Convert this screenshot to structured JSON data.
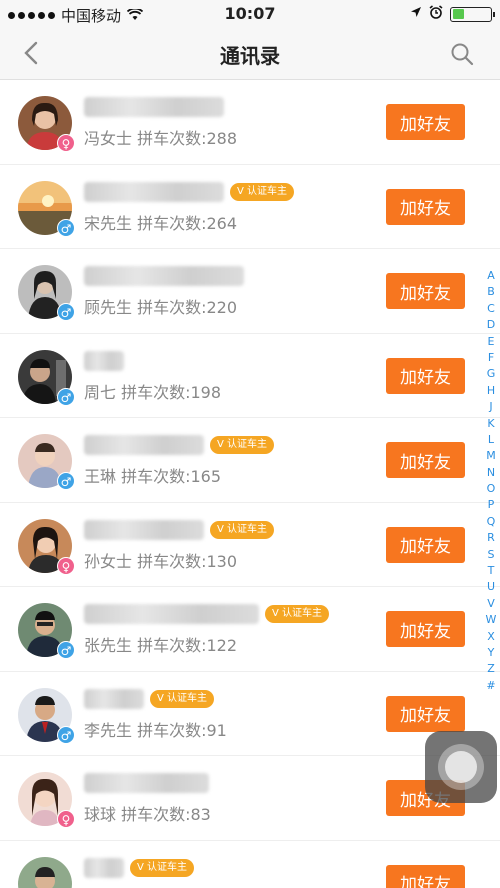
{
  "statusbar": {
    "carrier": "中国移动",
    "time": "10:07"
  },
  "navbar": {
    "title": "通讯录"
  },
  "add_label": "加好友",
  "verified_label": "V 认证车主",
  "contacts": [
    {
      "subtitle": "冯女士 拼车次数:288",
      "gender": "female",
      "symbol": "♀",
      "verified": false
    },
    {
      "subtitle": "宋先生 拼车次数:264",
      "gender": "male",
      "symbol": "♂",
      "verified": true
    },
    {
      "subtitle": "顾先生 拼车次数:220",
      "gender": "male",
      "symbol": "♂",
      "verified": false
    },
    {
      "subtitle": "周七 拼车次数:198",
      "gender": "male",
      "symbol": "♂",
      "verified": false
    },
    {
      "subtitle": "王琳 拼车次数:165",
      "gender": "male",
      "symbol": "♂",
      "verified": true
    },
    {
      "subtitle": "孙女士 拼车次数:130",
      "gender": "female",
      "symbol": "♀",
      "verified": true
    },
    {
      "subtitle": "张先生 拼车次数:122",
      "gender": "male",
      "symbol": "♂",
      "verified": true
    },
    {
      "subtitle": "李先生 拼车次数:91",
      "gender": "male",
      "symbol": "♂",
      "verified": true
    },
    {
      "subtitle": "球球 拼车次数:83",
      "gender": "female",
      "symbol": "♀",
      "verified": false
    },
    {
      "subtitle": "",
      "gender": "male",
      "symbol": "♂",
      "verified": true
    }
  ],
  "index_letters": [
    "A",
    "B",
    "C",
    "D",
    "E",
    "F",
    "G",
    "H",
    "J",
    "K",
    "L",
    "M",
    "N",
    "O",
    "P",
    "Q",
    "R",
    "S",
    "T",
    "U",
    "V",
    "W",
    "X",
    "Y",
    "Z",
    "#"
  ],
  "colors": {
    "accent": "#f7761f",
    "badge": "#f5a623",
    "index": "#2a8ee0",
    "female": "#f0608c",
    "male": "#3fa3e6"
  }
}
